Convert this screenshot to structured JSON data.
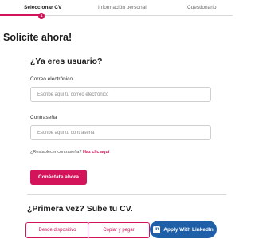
{
  "stepper": {
    "steps": [
      {
        "label": "Seleccionar CV",
        "active": true
      },
      {
        "label": "Información personal",
        "active": false
      },
      {
        "label": "Cuestionario",
        "active": false
      }
    ],
    "current_step_number": "1"
  },
  "page_title": "Solicite ahora!",
  "login": {
    "title": "¿Ya eres usuario?",
    "email_label": "Correo electrónico",
    "email_placeholder": "Escribe aquí tu correo electrónico",
    "email_value": "",
    "password_label": "Contraseña",
    "password_placeholder": "Escribe aquí tu contraseña",
    "password_value": "",
    "forgot_text": "¿Restablecer contraseña?",
    "forgot_link": "Haz clic aquí",
    "submit_label": "Conéctate ahora"
  },
  "upload": {
    "title": "¿Primera vez? Sube tu CV.",
    "device_label": "Desde dispositivo",
    "paste_label": "Copiar y pegar",
    "linkedin_label": "Apply With LinkedIn",
    "linkedin_icon_text": "in"
  },
  "colors": {
    "accent": "#d4145a",
    "linkedin": "#1f5fa8"
  },
  "icons": {
    "linkedin": "linkedin-icon"
  }
}
